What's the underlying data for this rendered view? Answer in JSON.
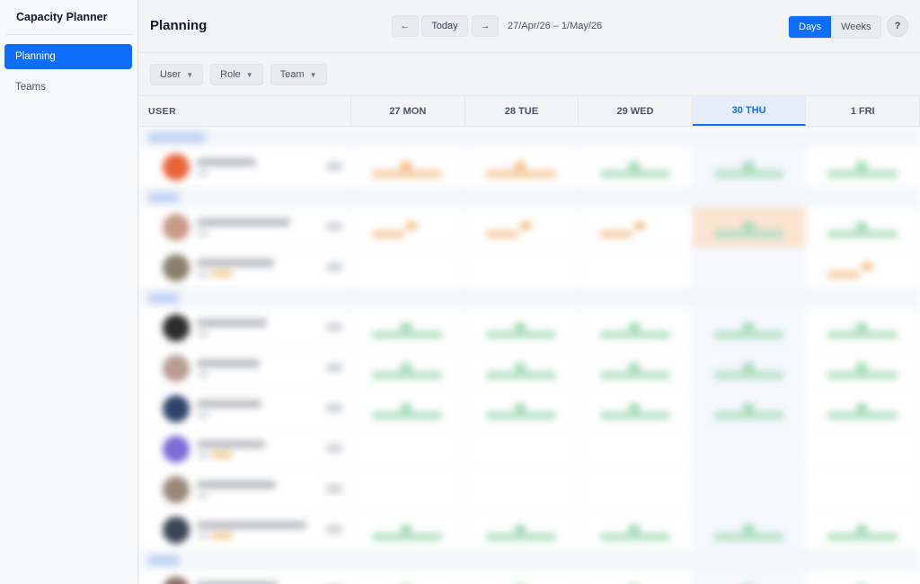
{
  "app": {
    "title": "Capacity Planner"
  },
  "sidebar": {
    "items": [
      {
        "label": "Planning",
        "active": true
      },
      {
        "label": "Teams",
        "active": false
      }
    ]
  },
  "header": {
    "title": "Planning",
    "prev": "←",
    "today": "Today",
    "next": "→",
    "date_range": "27/Apr/26 – 1/May/26",
    "view_days": "Days",
    "view_weeks": "Weeks",
    "help": "?"
  },
  "filters": {
    "user": "User",
    "role": "Role",
    "team": "Team",
    "caret": "▼"
  },
  "grid": {
    "user_header": "USER",
    "days": [
      {
        "label": "27 MON",
        "today": false
      },
      {
        "label": "28 TUE",
        "today": false
      },
      {
        "label": "29 WED",
        "today": false
      },
      {
        "label": "30 THU",
        "today": true
      },
      {
        "label": "1 FRI",
        "today": false
      }
    ]
  },
  "colors": {
    "accent": "#0d6efd",
    "available": "#b6e2c5",
    "partial": "#f8cfa4"
  }
}
